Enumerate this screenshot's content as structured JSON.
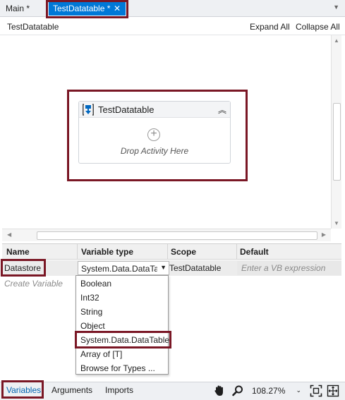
{
  "tabs": [
    {
      "label": "Main *"
    },
    {
      "label": "TestDatatable *",
      "close": "✕"
    }
  ],
  "header": {
    "breadcrumb": "TestDatatable",
    "expand_all": "Expand All",
    "collapse_all": "Collapse All"
  },
  "activity": {
    "title": "TestDatatable",
    "drop_text": "Drop Activity Here",
    "plus": "+",
    "collapse_glyph": "︽"
  },
  "variables_table": {
    "columns": [
      "Name",
      "Variable type",
      "Scope",
      "Default"
    ],
    "rows": [
      {
        "name": "Datastore",
        "type": "System.Data.DataTable",
        "scope": "TestDatatable",
        "default_placeholder": "Enter a VB expression"
      }
    ],
    "create_placeholder": "Create Variable"
  },
  "type_dropdown": {
    "options": [
      "Boolean",
      "Int32",
      "String",
      "Object",
      "System.Data.DataTable",
      "Array of [T]",
      "Browse for Types ..."
    ],
    "highlighted": "System.Data.DataTable"
  },
  "bottom_tabs": [
    "Variables",
    "Arguments",
    "Imports"
  ],
  "zoom": {
    "value": "108.27%"
  },
  "colors": {
    "accent": "#0078d7",
    "highlight_border": "#7a1725"
  }
}
